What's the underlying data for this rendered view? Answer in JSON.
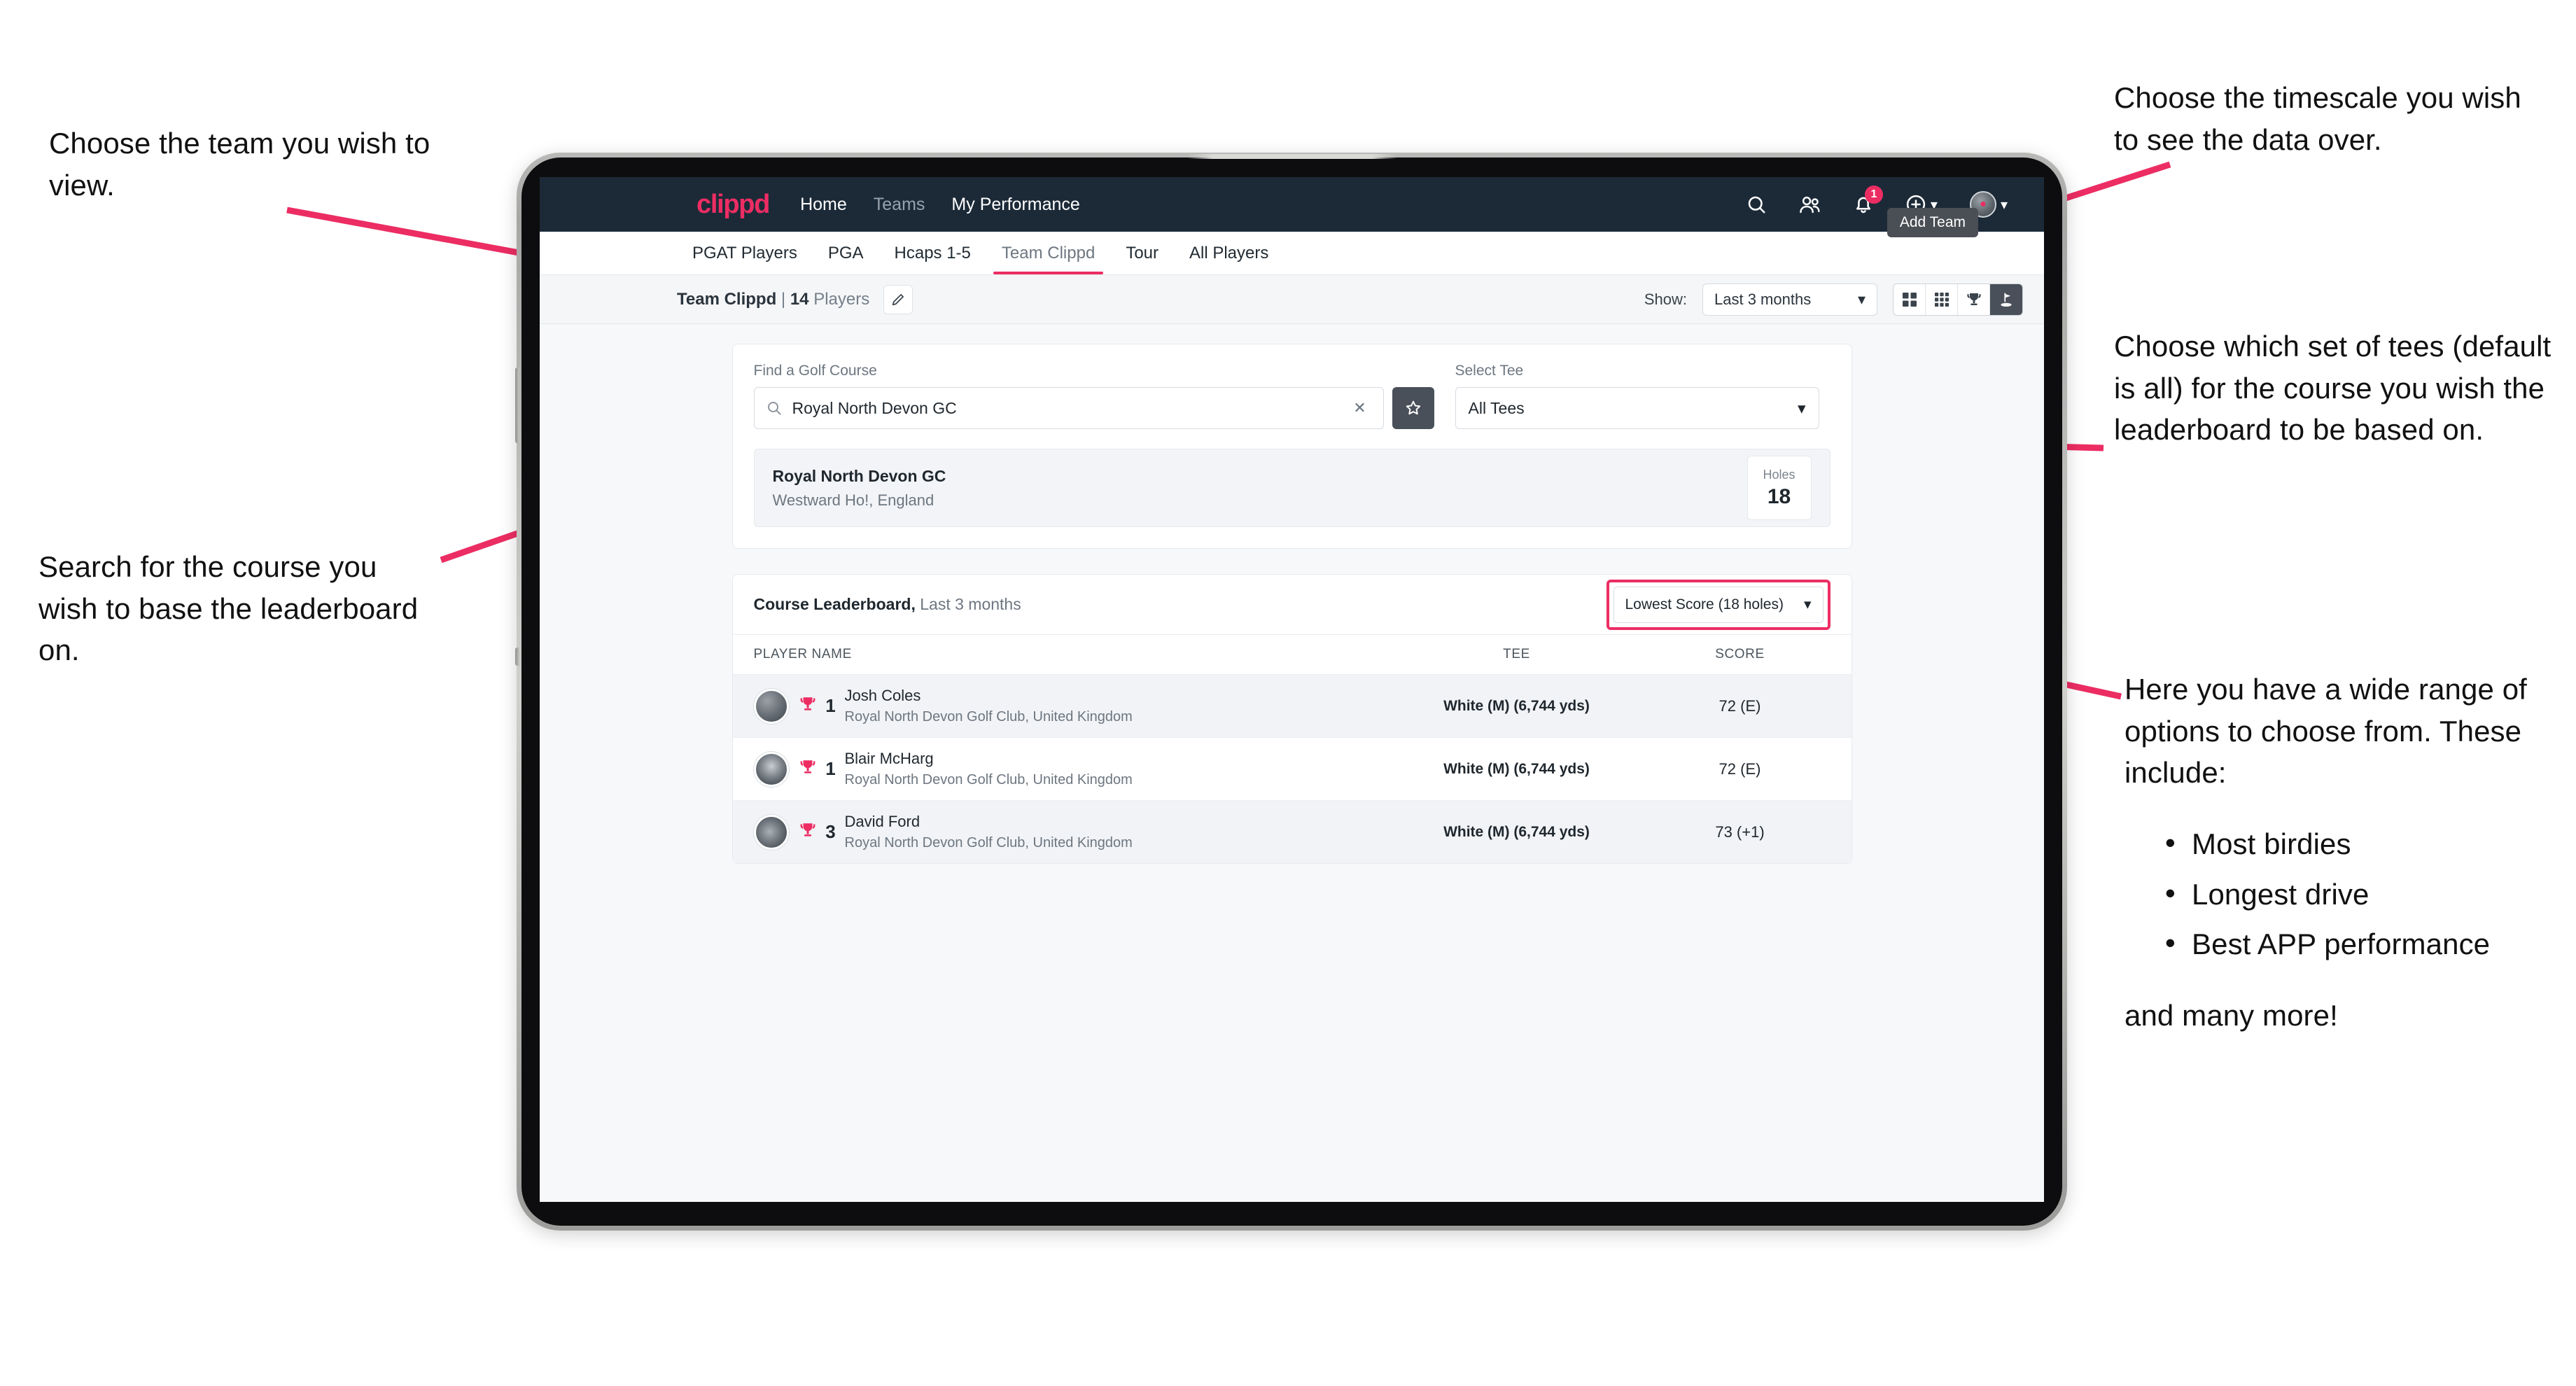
{
  "annotations": {
    "top_left": "Choose the team you wish to view.",
    "mid_left": "Search for the course you wish to base the leaderboard on.",
    "top_right": "Choose the timescale you wish to see the data over.",
    "mid_right": "Choose which set of tees (default is all) for the course you wish the leaderboard to be based on.",
    "bottom_right_intro": "Here you have a wide range of options to choose from. These include:",
    "bottom_right_items": [
      "Most birdies",
      "Longest drive",
      "Best APP performance"
    ],
    "bottom_right_tail": "and many more!",
    "bullet_glyph": "•"
  },
  "app": {
    "brand": "clippd",
    "nav": [
      {
        "label": "Home",
        "active": true
      },
      {
        "label": "Teams",
        "active": false
      },
      {
        "label": "My Performance",
        "active": true
      }
    ],
    "header_icons": [
      {
        "name": "search-icon"
      },
      {
        "name": "people-icon"
      },
      {
        "name": "bell-icon",
        "badge": "1"
      },
      {
        "name": "plus-circle-icon"
      },
      {
        "name": "avatar-icon"
      }
    ],
    "tooltip": "Add Team"
  },
  "tabs": [
    {
      "label": "PGAT Players",
      "state": "normal"
    },
    {
      "label": "PGA",
      "state": "normal"
    },
    {
      "label": "Hcaps 1-5",
      "state": "normal"
    },
    {
      "label": "Team Clippd",
      "state": "active"
    },
    {
      "label": "Tour",
      "state": "normal"
    },
    {
      "label": "All Players",
      "state": "normal"
    }
  ],
  "subbar": {
    "team_name": "Team Clippd",
    "separator": "|",
    "player_count": "14",
    "players_word": "Players",
    "edit_icon": "pencil-icon",
    "show_label": "Show:",
    "timescale_value": "Last 3 months",
    "view_toggles": [
      {
        "name": "grid-four-icon",
        "selected": false
      },
      {
        "name": "grid-nine-icon",
        "selected": false
      },
      {
        "name": "trophy-icon",
        "selected": false
      },
      {
        "name": "flag-icon",
        "selected": true
      }
    ]
  },
  "search": {
    "course_label": "Find a Golf Course",
    "course_value": "Royal North Devon GC",
    "course_placeholder": "Find a Golf Course",
    "clear_icon": "close-icon",
    "star_icon": "star-icon",
    "tee_label": "Select Tee",
    "tee_value": "All Tees"
  },
  "course_result": {
    "name": "Royal North Devon GC",
    "location": "Westward Ho!, England",
    "holes_label": "Holes",
    "holes_value": "18"
  },
  "leaderboard": {
    "title": "Course Leaderboard,",
    "subtitle": "Last 3 months",
    "sort_value": "Lowest Score (18 holes)",
    "columns": [
      "PLAYER NAME",
      "TEE",
      "SCORE"
    ],
    "rows": [
      {
        "rank": "1",
        "name": "Josh Coles",
        "club": "Royal North Devon Golf Club, United Kingdom",
        "tee": "White (M) (6,744 yds)",
        "score": "72 (E)"
      },
      {
        "rank": "1",
        "name": "Blair McHarg",
        "club": "Royal North Devon Golf Club, United Kingdom",
        "tee": "White (M) (6,744 yds)",
        "score": "72 (E)"
      },
      {
        "rank": "3",
        "name": "David Ford",
        "club": "Royal North Devon Golf Club, United Kingdom",
        "tee": "White (M) (6,744 yds)",
        "score": "73 (+1)"
      }
    ]
  },
  "colors": {
    "accent": "#ec2d63",
    "appbar": "#1c2a38",
    "toggle_selected": "#4a5059",
    "page_bg": "#f7f8fa"
  }
}
